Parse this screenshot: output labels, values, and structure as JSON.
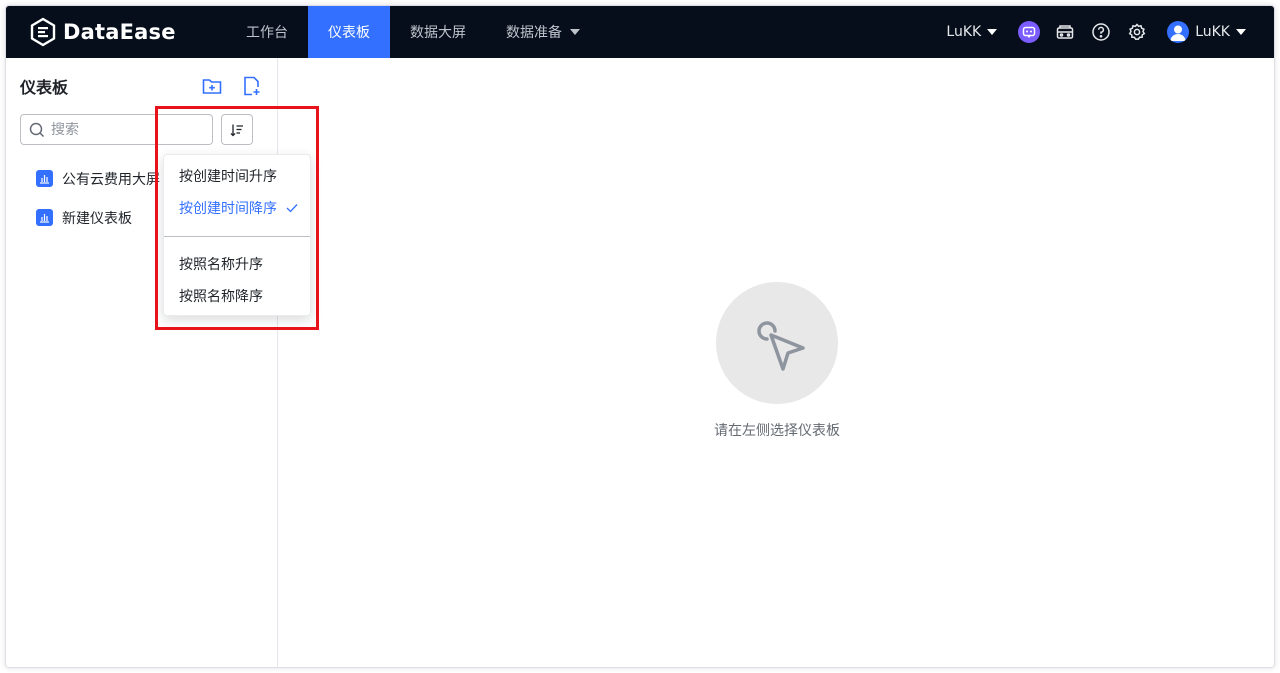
{
  "app": {
    "name": "DataEase"
  },
  "nav": {
    "items": [
      {
        "label": "工作台"
      },
      {
        "label": "仪表板"
      },
      {
        "label": "数据大屏"
      },
      {
        "label": "数据准备"
      }
    ]
  },
  "topbar": {
    "org": "LuKK",
    "user": "LuKK"
  },
  "sidebar": {
    "title": "仪表板",
    "search_placeholder": "搜索",
    "items": [
      {
        "label": "公有云费用大屏"
      },
      {
        "label": "新建仪表板"
      }
    ]
  },
  "sort_menu": {
    "items": [
      {
        "label": "按创建时间升序"
      },
      {
        "label": "按创建时间降序"
      },
      {
        "label": "按照名称升序"
      },
      {
        "label": "按照名称降序"
      }
    ]
  },
  "main": {
    "empty_text": "请在左侧选择仪表板"
  },
  "colors": {
    "accent": "#3370ff",
    "topbar_bg": "#050e1a",
    "highlight": "#e8121b"
  },
  "icons": {
    "logo": "dataease-logo-icon",
    "new_folder": "folder-add-icon",
    "new_dashboard": "file-add-icon",
    "search": "search-icon",
    "sort": "sort-icon",
    "check": "check-icon",
    "empty": "cursor-pointer-icon"
  }
}
